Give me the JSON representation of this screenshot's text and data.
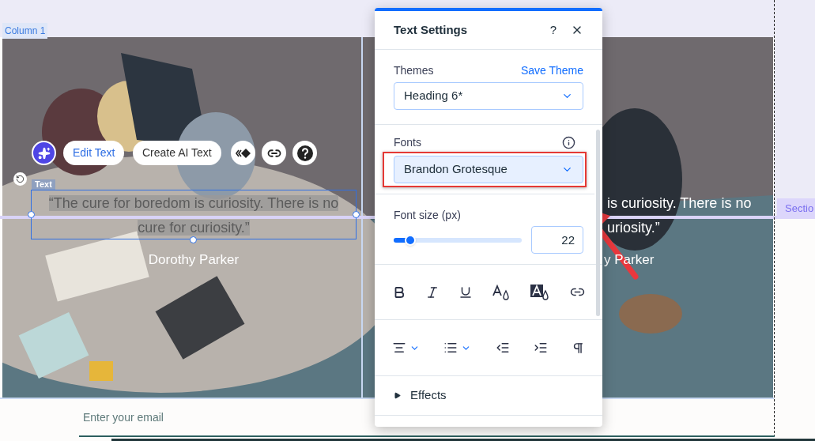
{
  "canvas": {
    "column_label": "Column 1",
    "section_label": "Sectio",
    "text_tag": "Text",
    "quote": "“The cure for boredom is curiosity. There is no cure for curiosity.”",
    "author": "Dorothy Parker",
    "right_quote_line1": "is curiosity. There is no",
    "right_quote_line2": "uriosity.”",
    "right_author": "y Parker",
    "email_placeholder": "Enter your email"
  },
  "toolbar": {
    "edit_button": "Edit Text",
    "ai_button": "Create AI Text"
  },
  "panel": {
    "title": "Text Settings",
    "help": "?",
    "themes": {
      "label": "Themes",
      "link": "Save Theme",
      "value": "Heading 6*"
    },
    "fonts": {
      "label": "Fonts",
      "value": "Brandon Grotesque",
      "highlighted": true
    },
    "font_size": {
      "label": "Font size (px)",
      "level": 0.13,
      "value": "22"
    },
    "effects": {
      "label": "Effects",
      "expanded": false
    }
  }
}
